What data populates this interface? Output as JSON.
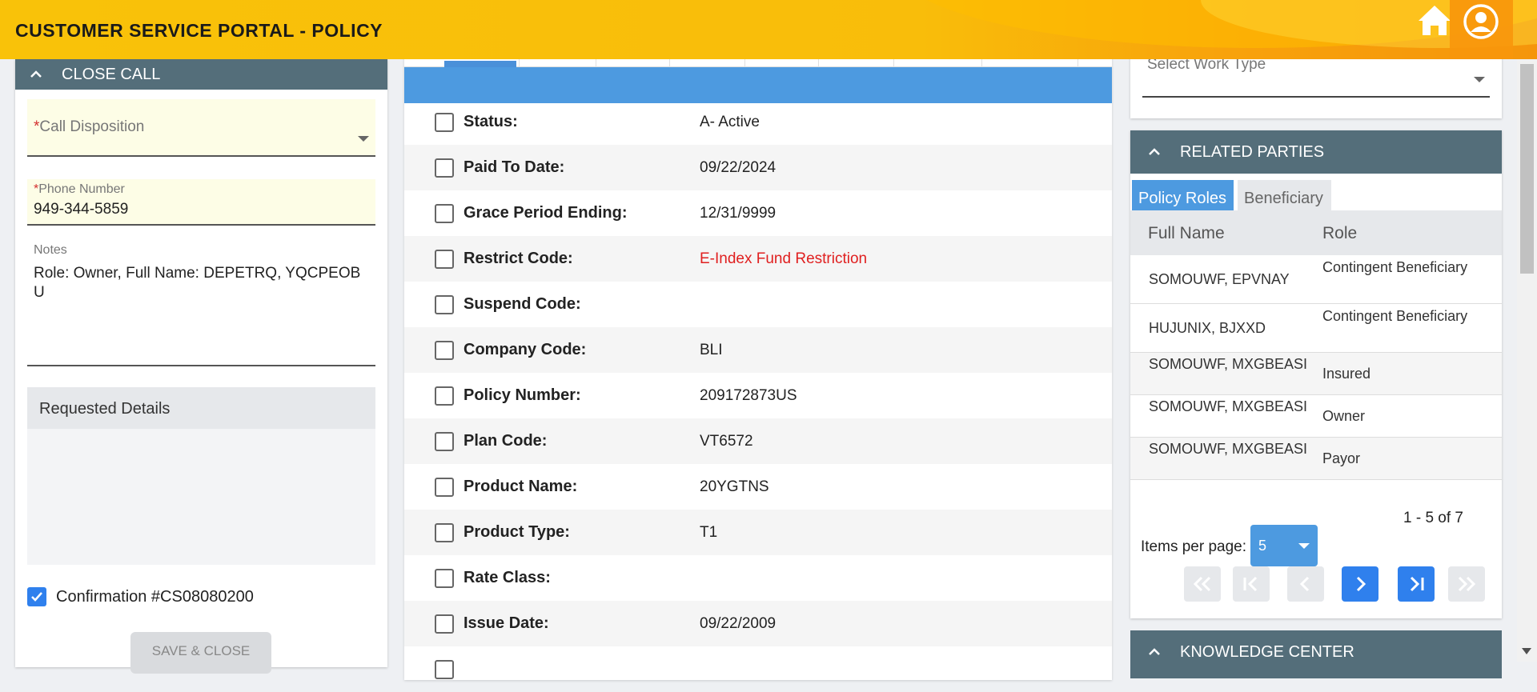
{
  "header": {
    "title": "CUSTOMER SERVICE PORTAL - POLICY"
  },
  "close_call": {
    "title": "CLOSE CALL",
    "call_disposition_label": "Call Disposition",
    "phone_label": "Phone Number",
    "phone_value": "949-344-5859",
    "notes_label": "Notes",
    "notes_value": "Role: Owner, Full Name: DEPETRQ, YQCPEOBU",
    "requested_details_label": "Requested Details",
    "confirmation_label": "Confirmation #CS08080200",
    "save_label": "SAVE & CLOSE",
    "required_marker": "*"
  },
  "policy_details": {
    "rows": [
      {
        "label": "Status:",
        "value": "A- Active"
      },
      {
        "label": "Paid To Date:",
        "value": "09/22/2024"
      },
      {
        "label": "Grace Period Ending:",
        "value": "12/31/9999"
      },
      {
        "label": "Restrict Code:",
        "value": "E-Index Fund Restriction"
      },
      {
        "label": "Suspend Code:",
        "value": ""
      },
      {
        "label": "Company Code:",
        "value": "BLI"
      },
      {
        "label": "Policy Number:",
        "value": "209172873US"
      },
      {
        "label": "Plan Code:",
        "value": "VT6572"
      },
      {
        "label": "Product Name:",
        "value": "20YGTNS"
      },
      {
        "label": "Product Type:",
        "value": "T1"
      },
      {
        "label": "Rate Class:",
        "value": ""
      },
      {
        "label": "Issue Date:",
        "value": "09/22/2009"
      }
    ],
    "restrict_color": "#e02020"
  },
  "work_type": {
    "placeholder": "Select Work Type"
  },
  "related_parties": {
    "title": "RELATED PARTIES",
    "tabs": [
      "Policy Roles",
      "Beneficiary"
    ],
    "columns": [
      "Full Name",
      "Role"
    ],
    "rows": [
      {
        "name": "SOMOUWF, EPVNAY",
        "role": "Contingent Beneficiary"
      },
      {
        "name": "HUJUNIX, BJXXD",
        "role": "Contingent Beneficiary"
      },
      {
        "name": "SOMOUWF, MXGBEASI",
        "role": "Insured"
      },
      {
        "name": "SOMOUWF, MXGBEASI",
        "role": "Owner"
      },
      {
        "name": "SOMOUWF, MXGBEASI",
        "role": "Payor"
      }
    ],
    "range_label": "1 - 5 of 7",
    "items_per_page_label": "Items per page:",
    "items_per_page_value": "5"
  },
  "knowledge_center": {
    "title": "KNOWLEDGE CENTER"
  },
  "colors": {
    "accent": "#4d9ae0",
    "panel_header": "#546e7a",
    "header_yellow": "#f9c209",
    "header_orange": "#f5950b"
  }
}
